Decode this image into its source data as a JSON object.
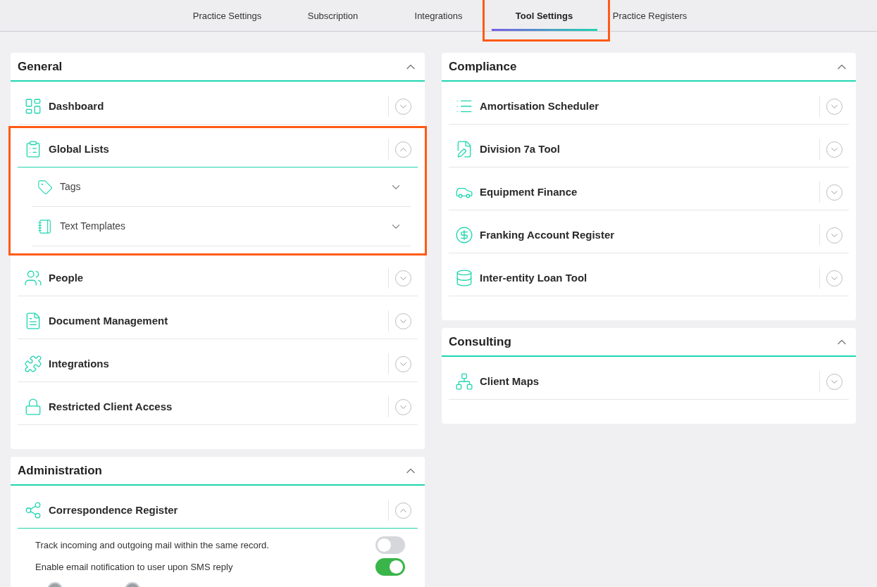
{
  "tabs": [
    {
      "label": "Practice Settings",
      "selected": false,
      "highlighted": false
    },
    {
      "label": "Subscription",
      "selected": false,
      "highlighted": false
    },
    {
      "label": "Integrations",
      "selected": false,
      "highlighted": false
    },
    {
      "label": "Tool Settings",
      "selected": true,
      "highlighted": true
    },
    {
      "label": "Practice Registers",
      "selected": false,
      "highlighted": false
    }
  ],
  "columns": [
    {
      "sections": [
        {
          "title": "General",
          "expanded": true,
          "items": [
            {
              "label": "Dashboard",
              "expanded": false,
              "highlighted": false
            },
            {
              "label": "Global Lists",
              "expanded": true,
              "highlighted": true,
              "children": [
                {
                  "label": "Tags",
                  "expanded": false
                },
                {
                  "label": "Text Templates",
                  "expanded": false
                }
              ]
            },
            {
              "label": "People",
              "expanded": false,
              "highlighted": false
            },
            {
              "label": "Document Management",
              "expanded": false,
              "highlighted": false
            },
            {
              "label": "Integrations",
              "expanded": false,
              "highlighted": false
            },
            {
              "label": "Restricted Client Access",
              "expanded": false,
              "highlighted": false
            }
          ]
        },
        {
          "title": "Administration",
          "expanded": true,
          "items": [
            {
              "label": "Correspondence Register",
              "expanded": true,
              "highlighted": false,
              "settings": [
                {
                  "label": "Track incoming and outgoing mail within the same record.",
                  "on": false
                },
                {
                  "label": "Enable email notification to user upon SMS reply",
                  "on": true
                }
              ]
            }
          ]
        }
      ]
    },
    {
      "sections": [
        {
          "title": "Compliance",
          "expanded": true,
          "items": [
            {
              "label": "Amortisation Scheduler",
              "expanded": false,
              "highlighted": false
            },
            {
              "label": "Division 7a Tool",
              "expanded": false,
              "highlighted": false
            },
            {
              "label": "Equipment Finance",
              "expanded": false,
              "highlighted": false
            },
            {
              "label": "Franking Account Register",
              "expanded": false,
              "highlighted": false
            },
            {
              "label": "Inter-entity Loan Tool",
              "expanded": false,
              "highlighted": false
            }
          ]
        },
        {
          "title": "Consulting",
          "expanded": true,
          "items": [
            {
              "label": "Client Maps",
              "expanded": false,
              "highlighted": false
            }
          ]
        }
      ]
    }
  ]
}
